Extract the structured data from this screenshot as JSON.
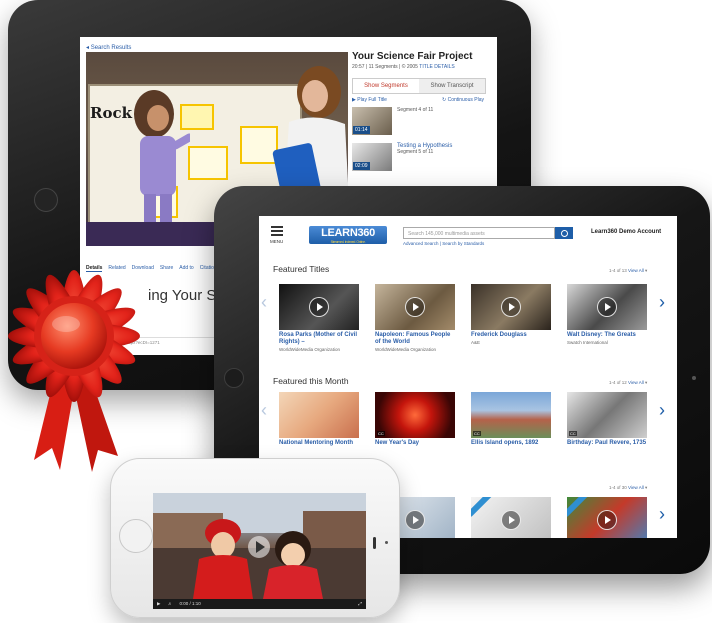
{
  "back_tablet": {
    "breadcrumb": "Search Results",
    "board_text": "Rock",
    "side": {
      "title": "Your Science Fair Project",
      "meta": "20:57 | 11 Segments | © 2005",
      "meta_link": "TITLE DETAILS",
      "tabs": [
        "Show Segments",
        "Show Transcript"
      ],
      "play_full": "Play Full Title",
      "continuous": "Continuous Play",
      "segments": [
        {
          "time": "01:14",
          "title": "",
          "sub": "Segment 4 of 11"
        },
        {
          "time": "02:09",
          "title": "Testing a Hypothesis",
          "sub": "Segment 5 of 11"
        }
      ]
    },
    "nav": [
      "Details",
      "Related",
      "Download",
      "Share",
      "Add to",
      "Citation"
    ],
    "page_title": "ing Your Scienc",
    "url": "com/PortalPlayTitle.aspx?ecDI=1271"
  },
  "front_tablet": {
    "menu_label": "MENU",
    "logo_text": "LEARN360",
    "logo_tag": "Streamed. Indexed. Online.",
    "search_placeholder": "Search 145,000 multimedia assets",
    "advanced_search": "Advanced Search | Search by Standards",
    "account": "Learn360 Demo Account",
    "sections": [
      {
        "title": "Featured Titles",
        "count": "1-4 of 13",
        "view": "View All",
        "cards": [
          {
            "title": "Rosa Parks (Mother of Civil Rights) –",
            "source": "WorldWideMedia Organization"
          },
          {
            "title": "Napoleon: Famous People of the World",
            "source": "WorldWideMedia Organization"
          },
          {
            "title": "Frederick Douglass",
            "source": "A&E"
          },
          {
            "title": "Walt Disney: The Greats",
            "source": "Swatch International"
          }
        ]
      },
      {
        "title": "Featured this Month",
        "count": "1-4 of 12",
        "view": "View All",
        "cards": [
          {
            "title": "National Mentoring Month",
            "source": ""
          },
          {
            "title": "New Year's Day",
            "source": ""
          },
          {
            "title": "Ellis Island opens, 1892",
            "source": ""
          },
          {
            "title": "Birthday: Paul Revere, 1735",
            "source": ""
          }
        ]
      },
      {
        "title": "",
        "count": "1-4 of 30",
        "view": "View All",
        "cards": []
      }
    ]
  },
  "phone": {
    "time": "0:00 / 1:10"
  },
  "colors": {
    "link_blue": "#2b5ea8",
    "brand_blue": "#1e5ea8",
    "ribbon_red": "#e2231a"
  }
}
